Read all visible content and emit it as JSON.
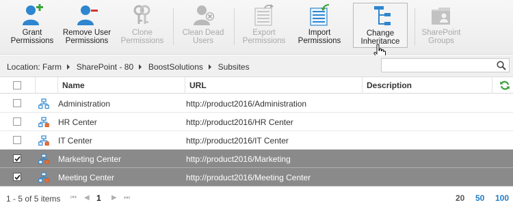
{
  "ribbon": {
    "buttons": [
      {
        "label": "Grant\nPermissions",
        "icon": "grant-user-icon",
        "enabled": true
      },
      {
        "label": "Remove User\nPermissions",
        "icon": "remove-user-icon",
        "enabled": true
      },
      {
        "label": "Clone\nPermissions",
        "icon": "keys-icon",
        "enabled": false
      },
      {
        "label": "Clean Dead\nUsers",
        "icon": "clean-user-icon",
        "enabled": false
      },
      {
        "label": "Export\nPermissions",
        "icon": "export-icon",
        "enabled": false
      },
      {
        "label": "Import\nPermissions",
        "icon": "import-icon",
        "enabled": true
      },
      {
        "label": "Change\nInheritance",
        "icon": "inheritance-icon",
        "enabled": true
      },
      {
        "label": "SharePoint\nGroups",
        "icon": "groups-icon",
        "enabled": false
      }
    ]
  },
  "breadcrumb": {
    "prefix": "Location:",
    "items": [
      "Farm",
      "SharePoint - 80",
      "BoostSolutions",
      "Subsites"
    ]
  },
  "search": {
    "placeholder": ""
  },
  "grid": {
    "columns": {
      "name": "Name",
      "url": "URL",
      "description": "Description"
    },
    "rows": [
      {
        "name": "Administration",
        "url": "http://product2016/Administration",
        "description": "",
        "checked": false
      },
      {
        "name": "HR Center",
        "url": "http://product2016/HR Center",
        "description": "",
        "checked": false
      },
      {
        "name": "IT Center",
        "url": "http://product2016/IT Center",
        "description": "",
        "checked": false
      },
      {
        "name": "Marketing Center",
        "url": "http://product2016/Marketing",
        "description": "",
        "checked": true
      },
      {
        "name": "Meeting Center",
        "url": "http://product2016/Meeting Center",
        "description": "",
        "checked": true
      }
    ]
  },
  "pager": {
    "info": "1 - 5 of 5 items",
    "current_page": "1",
    "page_sizes": [
      "20",
      "50",
      "100"
    ]
  },
  "colors": {
    "accent_blue": "#1e7bc4",
    "selected_row": "#8a8a8a",
    "refresh_green": "#3aa03a",
    "remove_red": "#d9322b"
  }
}
